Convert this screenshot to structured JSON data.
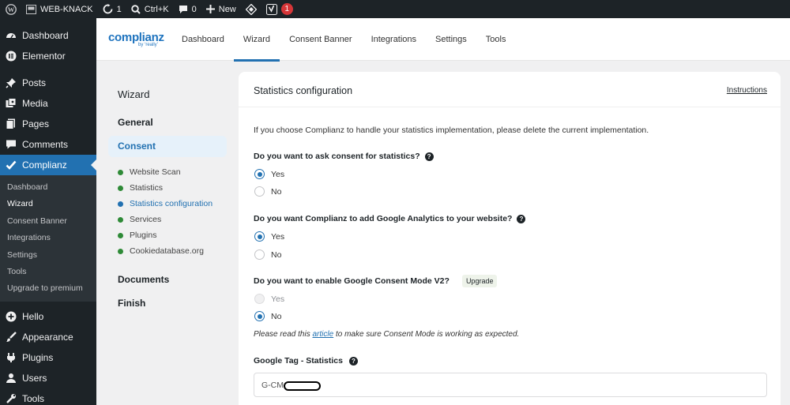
{
  "adminbar": {
    "site_name": "WEB-KNACK",
    "updates_count": "1",
    "search_shortcut": "Ctrl+K",
    "comments_count": "0",
    "new_label": "New",
    "notification_count": "1"
  },
  "menu": {
    "dashboard": "Dashboard",
    "elementor": "Elementor",
    "posts": "Posts",
    "media": "Media",
    "pages": "Pages",
    "comments": "Comments",
    "complianz": "Complianz",
    "submenu": [
      "Dashboard",
      "Wizard",
      "Consent Banner",
      "Integrations",
      "Settings",
      "Tools",
      "Upgrade to premium"
    ],
    "hello": "Hello",
    "appearance": "Appearance",
    "plugins": "Plugins",
    "users": "Users",
    "tools": "Tools"
  },
  "header": {
    "logo": "complianz",
    "logo_sub": "by ‘really’",
    "tabs": [
      "Dashboard",
      "Wizard",
      "Consent Banner",
      "Integrations",
      "Settings",
      "Tools"
    ],
    "active_tab": "Wizard"
  },
  "wizard": {
    "title": "Wizard",
    "general": "General",
    "consent": "Consent",
    "steps": [
      "Website Scan",
      "Statistics",
      "Statistics configuration",
      "Services",
      "Plugins",
      "Cookiedatabase.org"
    ],
    "documents": "Documents",
    "finish": "Finish"
  },
  "panel": {
    "title": "Statistics configuration",
    "instructions": "Instructions",
    "intro": "If you choose Complianz to handle your statistics implementation, please delete the current implementation.",
    "q1": "Do you want to ask consent for statistics?",
    "q2": "Do you want Complianz to add Google Analytics to your website?",
    "q3": "Do you want to enable Google Consent Mode V2?",
    "upgrade": "Upgrade",
    "yes": "Yes",
    "no": "No",
    "note_before": "Please read this ",
    "note_link": "article",
    "note_after": " to make sure Consent Mode is working as expected.",
    "tag_label": "Google Tag - Statistics",
    "tag_value": "G-CM"
  },
  "colors": {
    "accent": "#2271b1",
    "admin_dark": "#1d2327",
    "success": "#2e8a37",
    "badge": "#d63638"
  }
}
